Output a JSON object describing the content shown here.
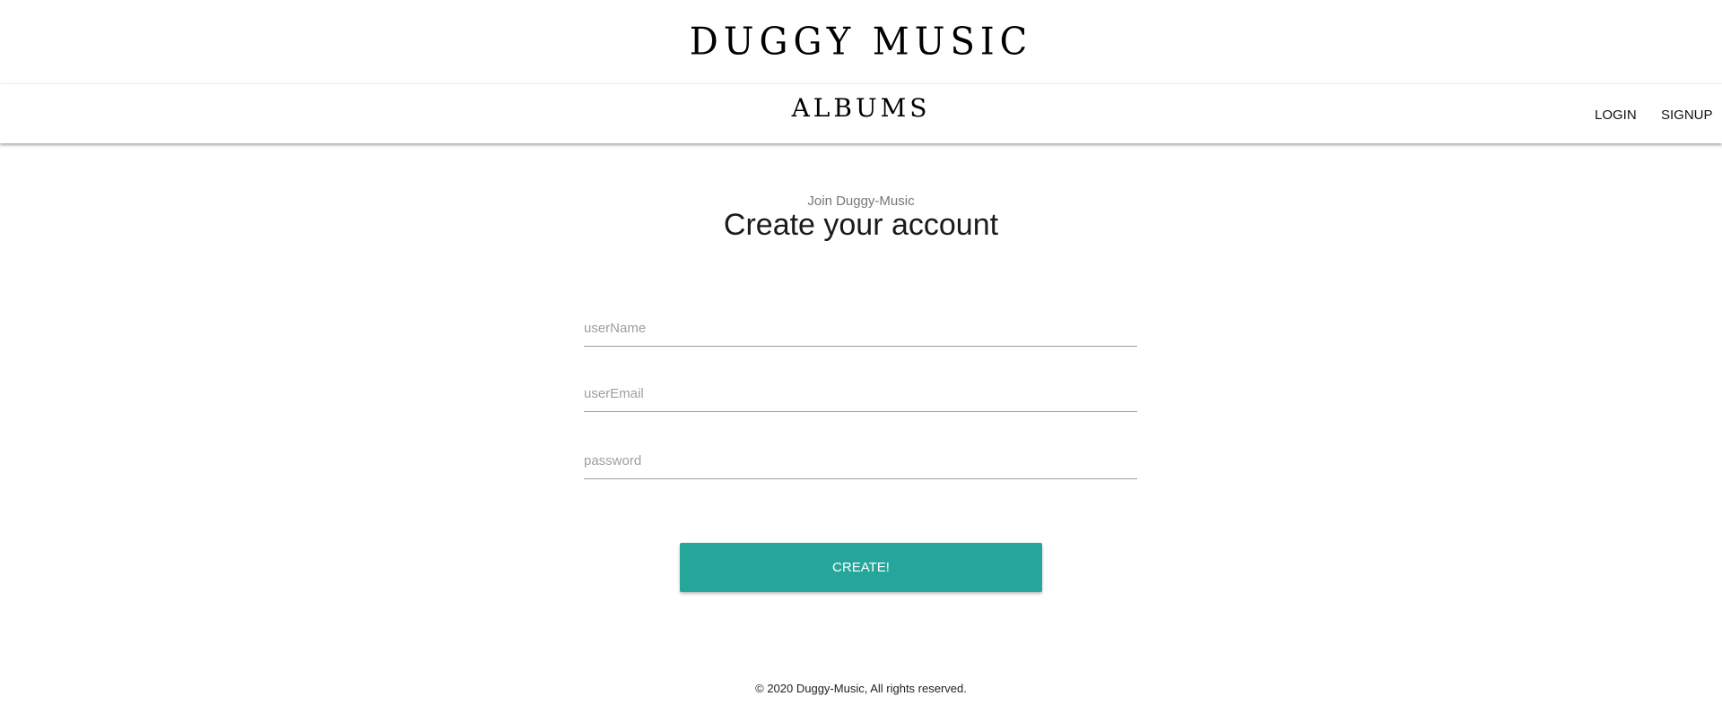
{
  "header": {
    "brand": "DUGGY MUSIC"
  },
  "nav": {
    "center_link": "ALBUMS",
    "login": "LOGIN",
    "signup": "SIGNUP"
  },
  "form": {
    "subtitle": "Join Duggy-Music",
    "title": "Create your account",
    "fields": [
      {
        "placeholder": "userName",
        "value": ""
      },
      {
        "placeholder": "userEmail",
        "value": ""
      },
      {
        "placeholder": "password",
        "value": ""
      }
    ],
    "submit_label": "CREATE!",
    "accent_color": "#26a69a"
  },
  "footer": {
    "text": "© 2020 Duggy-Music, All rights reserved."
  }
}
